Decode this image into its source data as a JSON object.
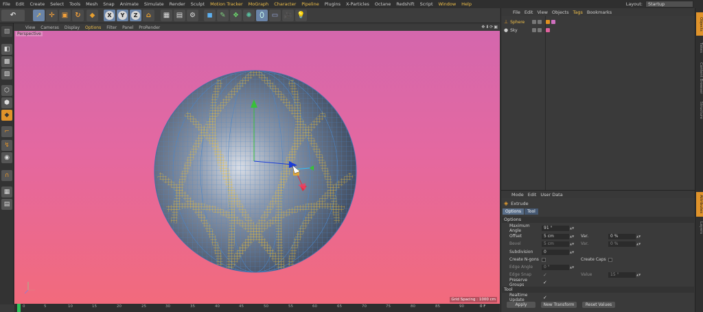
{
  "menubar": {
    "items": [
      "File",
      "Edit",
      "Create",
      "Select",
      "Tools",
      "Mesh",
      "Snap",
      "Animate",
      "Simulate",
      "Render",
      "Sculpt",
      "Motion Tracker",
      "MoGraph",
      "Character",
      "Pipeline",
      "Plugins",
      "X-Particles",
      "Octane",
      "Redshift",
      "Script",
      "Window",
      "Help"
    ],
    "layout_label": "Layout:",
    "layout_value": "Startup"
  },
  "toolbar": {
    "axis_x": "X",
    "axis_y": "Y",
    "axis_z": "Z"
  },
  "viewport": {
    "menu": [
      "View",
      "Cameras",
      "Display",
      "Options",
      "Filter",
      "Panel",
      "ProRender"
    ],
    "name": "Perspective",
    "grid_spacing": "Grid Spacing : 1000 cm",
    "bg_top": "#d467ad",
    "bg_bottom": "#f26a7c"
  },
  "timeline": {
    "ticks": [
      "0",
      "5",
      "10",
      "15",
      "20",
      "25",
      "30",
      "35",
      "40",
      "45",
      "50",
      "55",
      "60",
      "65",
      "70",
      "75",
      "80",
      "85",
      "90"
    ],
    "current_frame": "0 F"
  },
  "objects_panel": {
    "menu": [
      "File",
      "Edit",
      "View",
      "Objects",
      "Tags",
      "Bookmarks"
    ],
    "objects": [
      {
        "name": "Sphere",
        "selected": true
      },
      {
        "name": "Sky",
        "selected": false
      }
    ]
  },
  "attributes": {
    "menu": [
      "Mode",
      "Edit",
      "User Data"
    ],
    "title": "Extrude",
    "tabs": [
      "Options",
      "Tool"
    ],
    "section_options": "Options",
    "section_tool": "Tool",
    "maximum_angle": {
      "label": "Maximum Angle",
      "value": "91 °"
    },
    "offset": {
      "label": "Offset",
      "value": "5 cm"
    },
    "var1": {
      "label": "Var.",
      "value": "0 %"
    },
    "bevel": {
      "label": "Bevel",
      "value": "5 cm"
    },
    "var2": {
      "label": "Var.",
      "value": "0 %"
    },
    "subdivision": {
      "label": "Subdivision",
      "value": "0"
    },
    "create_ngons": {
      "label": "Create N-gons"
    },
    "create_caps": {
      "label": "Create Caps"
    },
    "edge_angle": {
      "label": "Edge Angle",
      "value": "0 °"
    },
    "edge_snap": {
      "label": "Edge Snap",
      "check": "✓"
    },
    "value": {
      "label": "Value",
      "value": "15 °"
    },
    "preserve_groups": {
      "label": "Preserve Groups",
      "check": "✓"
    },
    "realtime_update": {
      "label": "Realtime Update",
      "check": "✓"
    },
    "buttons": {
      "apply": "Apply",
      "new_transform": "New Transform",
      "reset_values": "Reset Values"
    }
  },
  "side_tabs": [
    "Objects",
    "Takes",
    "Content Browser",
    "Structure",
    "Attributes",
    "Layers"
  ],
  "colors": {
    "accent": "#f2c14a",
    "active_tab": "#e0932a",
    "wire": "#4b86c8",
    "selection": "#e8b02e"
  }
}
